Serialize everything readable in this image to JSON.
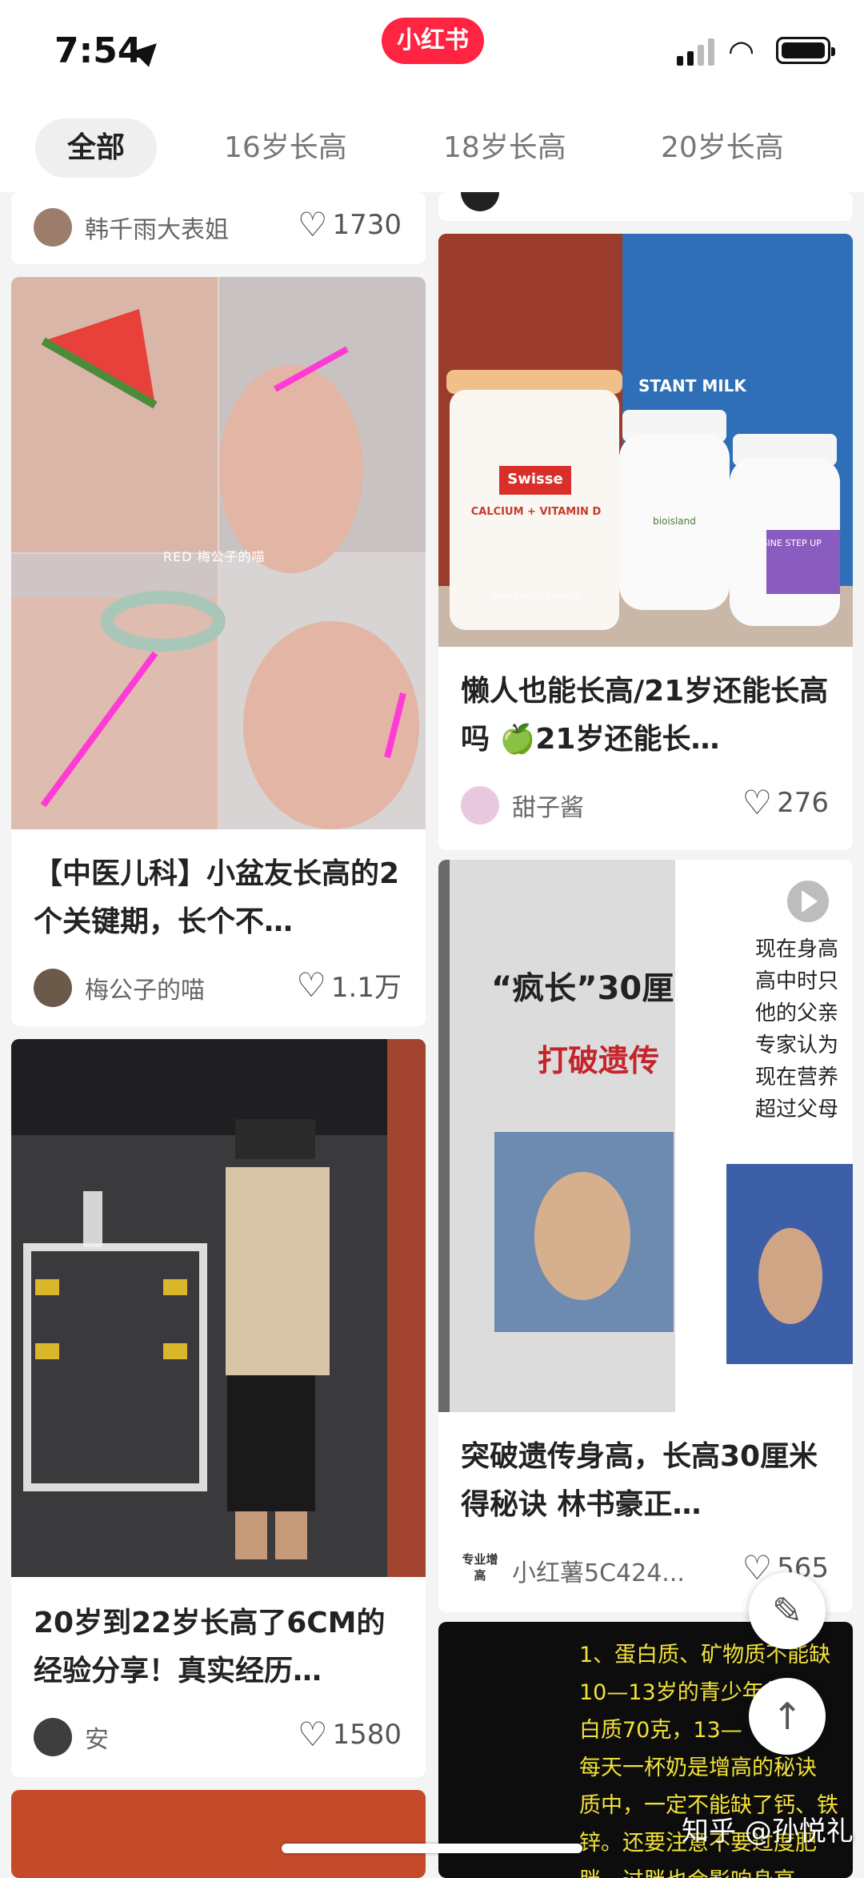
{
  "status_bar": {
    "time": "7:54",
    "app_badge": "小红书"
  },
  "tabs": [
    {
      "label": "全部",
      "active": true
    },
    {
      "label": "16岁长高",
      "active": false
    },
    {
      "label": "18岁长高",
      "active": false
    },
    {
      "label": "20岁长高",
      "active": false
    }
  ],
  "feed": {
    "left": [
      {
        "author": "韩千雨大表姐",
        "likes": "1730"
      },
      {
        "title": "【中医儿科】小盆友长高的2个关键期，长个不…",
        "author": "梅公子的喵",
        "likes": "1.1万",
        "image_text": "RED 梅公子的喵"
      },
      {
        "title": "20岁到22岁长高了6CM的经验分享！真实经历…",
        "author": "安",
        "likes": "1580"
      }
    ],
    "right": [
      {
        "title": "懒人也能长高/21岁还能长高吗 🍏21岁还能长…",
        "author": "甜子酱",
        "likes": "276",
        "image_texts": [
          "Swisse",
          "CALCIUM + VITAMIN D",
          "BONE & MUSCLE HEALTH",
          "bioisland",
          "LYSINE STEP UP",
          "STANT MILK"
        ]
      },
      {
        "title": "突破遗传身高，长高30厘米得秘诀 林书豪正…",
        "author": "小红薯5C424...",
        "author_badge": "专业增高",
        "likes": "565",
        "image_texts": [
          "“疯长”30厘",
          "打破遗传",
          "现在身高",
          "高中时只",
          "他的父亲",
          "专家认为",
          "现在营养",
          "超过父母"
        ]
      },
      {
        "image_lines": [
          "1、蛋白质、矿物质不能缺",
          "10—13岁的青少年每天",
          "白质70克，13—",
          "每天一杯奶是增高的秘诀",
          "质中，一定不能缺了钙、铁",
          "锌。还要注意不要过度肥",
          "胖，过胖也会影响身高。"
        ]
      }
    ]
  },
  "watermark": "知乎 @孙悦礼",
  "colors": {
    "brand": "#ff2442",
    "background": "#f4f4f4"
  }
}
